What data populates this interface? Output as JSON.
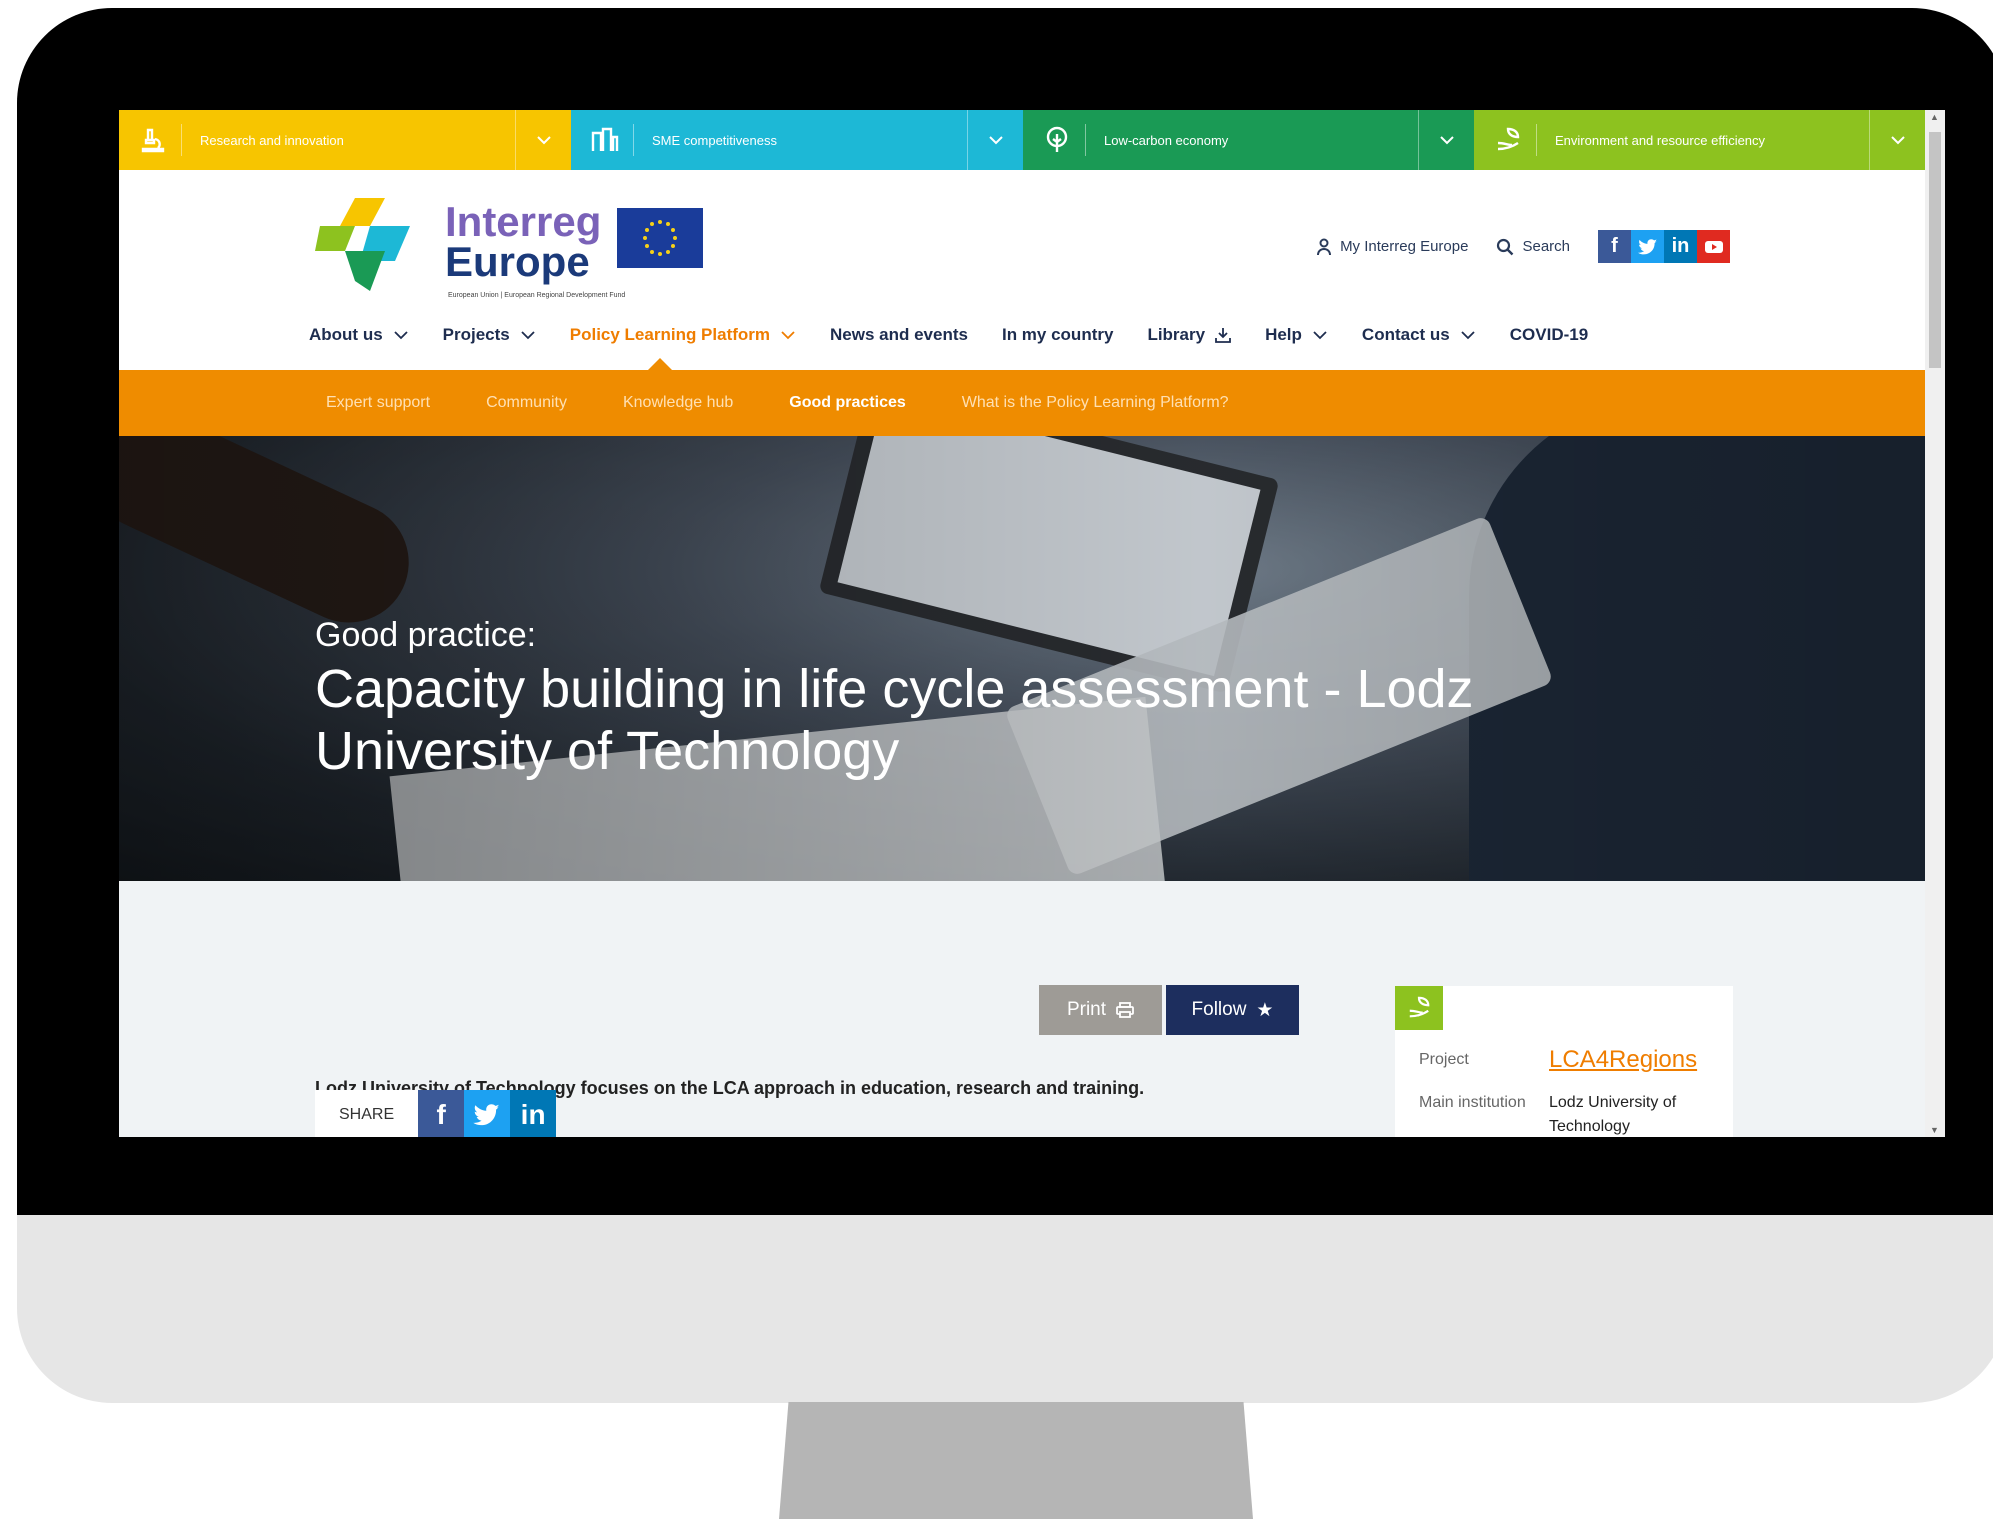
{
  "colors": {
    "research": "#f7c500",
    "sme": "#1db8d6",
    "lowcarbon": "#1a9a55",
    "environment": "#8dc21f",
    "accent": "#ef7d00",
    "subnav": "#ef8c00",
    "navy": "#1d2e5e"
  },
  "themes": [
    {
      "label": "Research and innovation",
      "icon": "microscope-icon"
    },
    {
      "label": "SME competitiveness",
      "icon": "buildings-icon"
    },
    {
      "label": "Low-carbon economy",
      "icon": "tree-icon"
    },
    {
      "label": "Environment and resource efficiency",
      "icon": "hand-leaf-icon"
    }
  ],
  "header": {
    "logo_line1": "Interreg",
    "logo_line2": "Europe",
    "logo_tagline": "European Union | European Regional Development Fund",
    "my_account": "My Interreg Europe",
    "search": "Search"
  },
  "nav": {
    "items": [
      "About us",
      "Projects",
      "Policy Learning Platform",
      "News and events",
      "In my country",
      "Library",
      "Help",
      "Contact us",
      "COVID-19"
    ]
  },
  "subnav": {
    "items": [
      "Expert support",
      "Community",
      "Knowledge hub",
      "Good practices",
      "What is the Policy Learning Platform?"
    ]
  },
  "hero": {
    "kicker": "Good practice:",
    "title": "Capacity building in life cycle assessment - Lodz University of Technology"
  },
  "actions": {
    "print": "Print",
    "follow": "Follow"
  },
  "content": {
    "intro": "Lodz University of Technology focuses on the LCA approach in education, research and training.",
    "share_label": "SHARE"
  },
  "sidecard": {
    "project_key": "Project",
    "project_value": "LCA4Regions",
    "institution_key": "Main institution",
    "institution_value": "Lodz University of Technology"
  }
}
